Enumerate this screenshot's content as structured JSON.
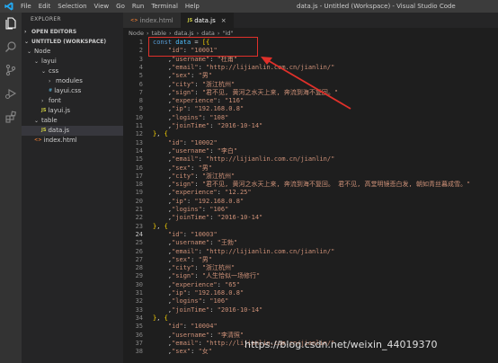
{
  "menu": [
    "File",
    "Edit",
    "Selection",
    "View",
    "Go",
    "Run",
    "Terminal",
    "Help"
  ],
  "window_title": "data.js - Untitled (Workspace) - Visual Studio Code",
  "sidebar": {
    "title": "EXPLORER",
    "open_editors": "OPEN EDITORS",
    "workspace": "UNTITLED (WORKSPACE)",
    "tree": [
      {
        "label": "Node",
        "type": "folder",
        "level": 0
      },
      {
        "label": "layui",
        "type": "folder",
        "level": 1
      },
      {
        "label": "css",
        "type": "folder",
        "level": 2
      },
      {
        "label": "modules",
        "type": "folder-collapsed",
        "level": 3
      },
      {
        "label": "layui.css",
        "type": "css",
        "level": 3
      },
      {
        "label": "font",
        "type": "folder-collapsed",
        "level": 2
      },
      {
        "label": "layui.js",
        "type": "js",
        "level": 2
      },
      {
        "label": "table",
        "type": "folder",
        "level": 1
      },
      {
        "label": "data.js",
        "type": "js",
        "level": 2,
        "selected": true
      },
      {
        "label": "index.html",
        "type": "html",
        "level": 1
      }
    ]
  },
  "tabs": [
    {
      "label": "index.html",
      "icon": "html-file-icon",
      "active": false
    },
    {
      "label": "data.js",
      "icon": "js-file-icon",
      "active": true
    }
  ],
  "breadcrumb": [
    "Node",
    "table",
    "data.js",
    "data",
    "\"id\""
  ],
  "editor": {
    "current_line": 24,
    "lines": [
      [
        [
          "k",
          "const "
        ],
        [
          "v",
          "data"
        ],
        [
          "p",
          " = "
        ],
        [
          "br",
          "[{"
        ]
      ],
      [
        [
          "p",
          "    "
        ],
        [
          "s",
          "\"id\""
        ],
        [
          "p",
          ": "
        ],
        [
          "s",
          "\"10001\""
        ]
      ],
      [
        [
          "p",
          "    ,"
        ],
        [
          "s",
          "\"username\""
        ],
        [
          "p",
          ": "
        ],
        [
          "s",
          "\"杜甫\""
        ]
      ],
      [
        [
          "p",
          "    ,"
        ],
        [
          "s",
          "\"email\""
        ],
        [
          "p",
          ": "
        ],
        [
          "s",
          "\"http://lijianlin.com.cn/jianlin/\""
        ]
      ],
      [
        [
          "p",
          "    ,"
        ],
        [
          "s",
          "\"sex\""
        ],
        [
          "p",
          ": "
        ],
        [
          "s",
          "\"男\""
        ]
      ],
      [
        [
          "p",
          "    ,"
        ],
        [
          "s",
          "\"city\""
        ],
        [
          "p",
          ": "
        ],
        [
          "s",
          "\"浙江杭州\""
        ]
      ],
      [
        [
          "p",
          "    ,"
        ],
        [
          "s",
          "\"sign\""
        ],
        [
          "p",
          ": "
        ],
        [
          "s",
          "\"君不见, 黄河之水天上来, 奔流到海不复回。\""
        ]
      ],
      [
        [
          "p",
          "    ,"
        ],
        [
          "s",
          "\"experience\""
        ],
        [
          "p",
          ": "
        ],
        [
          "s",
          "\"116\""
        ]
      ],
      [
        [
          "p",
          "    ,"
        ],
        [
          "s",
          "\"ip\""
        ],
        [
          "p",
          ": "
        ],
        [
          "s",
          "\"192.168.0.8\""
        ]
      ],
      [
        [
          "p",
          "    ,"
        ],
        [
          "s",
          "\"logins\""
        ],
        [
          "p",
          ": "
        ],
        [
          "s",
          "\"108\""
        ]
      ],
      [
        [
          "p",
          "    ,"
        ],
        [
          "s",
          "\"joinTime\""
        ],
        [
          "p",
          ": "
        ],
        [
          "s",
          "\"2016-10-14\""
        ]
      ],
      [
        [
          "br",
          "}"
        ],
        [
          "p",
          ", "
        ],
        [
          "br",
          "{"
        ]
      ],
      [
        [
          "p",
          "    "
        ],
        [
          "s",
          "\"id\""
        ],
        [
          "p",
          ": "
        ],
        [
          "s",
          "\"10002\""
        ]
      ],
      [
        [
          "p",
          "    ,"
        ],
        [
          "s",
          "\"username\""
        ],
        [
          "p",
          ": "
        ],
        [
          "s",
          "\"李白\""
        ]
      ],
      [
        [
          "p",
          "    ,"
        ],
        [
          "s",
          "\"email\""
        ],
        [
          "p",
          ": "
        ],
        [
          "s",
          "\"http://lijianlin.com.cn/jianlin/\""
        ]
      ],
      [
        [
          "p",
          "    ,"
        ],
        [
          "s",
          "\"sex\""
        ],
        [
          "p",
          ": "
        ],
        [
          "s",
          "\"男\""
        ]
      ],
      [
        [
          "p",
          "    ,"
        ],
        [
          "s",
          "\"city\""
        ],
        [
          "p",
          ": "
        ],
        [
          "s",
          "\"浙江杭州\""
        ]
      ],
      [
        [
          "p",
          "    ,"
        ],
        [
          "s",
          "\"sign\""
        ],
        [
          "p",
          ": "
        ],
        [
          "s",
          "\"君不见, 黄河之水天上来, 奔流到海不复回。 君不见, 高堂明镜悲白发, 朝如青丝暮成雪。\""
        ]
      ],
      [
        [
          "p",
          "    ,"
        ],
        [
          "s",
          "\"experience\""
        ],
        [
          "p",
          ": "
        ],
        [
          "s",
          "\"12.25\""
        ]
      ],
      [
        [
          "p",
          "    ,"
        ],
        [
          "s",
          "\"ip\""
        ],
        [
          "p",
          ": "
        ],
        [
          "s",
          "\"192.168.0.8\""
        ]
      ],
      [
        [
          "p",
          "    ,"
        ],
        [
          "s",
          "\"logins\""
        ],
        [
          "p",
          ": "
        ],
        [
          "s",
          "\"106\""
        ]
      ],
      [
        [
          "p",
          "    ,"
        ],
        [
          "s",
          "\"joinTime\""
        ],
        [
          "p",
          ": "
        ],
        [
          "s",
          "\"2016-10-14\""
        ]
      ],
      [
        [
          "br",
          "}"
        ],
        [
          "p",
          ", "
        ],
        [
          "br",
          "{"
        ]
      ],
      [
        [
          "p",
          "    "
        ],
        [
          "s",
          "\"id\""
        ],
        [
          "p",
          ": "
        ],
        [
          "s",
          "\"10003\""
        ]
      ],
      [
        [
          "p",
          "    ,"
        ],
        [
          "s",
          "\"username\""
        ],
        [
          "p",
          ": "
        ],
        [
          "s",
          "\"王勃\""
        ]
      ],
      [
        [
          "p",
          "    ,"
        ],
        [
          "s",
          "\"email\""
        ],
        [
          "p",
          ": "
        ],
        [
          "s",
          "\"http://lijianlin.com.cn/jianlin/\""
        ]
      ],
      [
        [
          "p",
          "    ,"
        ],
        [
          "s",
          "\"sex\""
        ],
        [
          "p",
          ": "
        ],
        [
          "s",
          "\"男\""
        ]
      ],
      [
        [
          "p",
          "    ,"
        ],
        [
          "s",
          "\"city\""
        ],
        [
          "p",
          ": "
        ],
        [
          "s",
          "\"浙江杭州\""
        ]
      ],
      [
        [
          "p",
          "    ,"
        ],
        [
          "s",
          "\"sign\""
        ],
        [
          "p",
          ": "
        ],
        [
          "s",
          "\"人生恰似一场修行\""
        ]
      ],
      [
        [
          "p",
          "    ,"
        ],
        [
          "s",
          "\"experience\""
        ],
        [
          "p",
          ": "
        ],
        [
          "s",
          "\"65\""
        ]
      ],
      [
        [
          "p",
          "    ,"
        ],
        [
          "s",
          "\"ip\""
        ],
        [
          "p",
          ": "
        ],
        [
          "s",
          "\"192.168.0.8\""
        ]
      ],
      [
        [
          "p",
          "    ,"
        ],
        [
          "s",
          "\"logins\""
        ],
        [
          "p",
          ": "
        ],
        [
          "s",
          "\"106\""
        ]
      ],
      [
        [
          "p",
          "    ,"
        ],
        [
          "s",
          "\"joinTime\""
        ],
        [
          "p",
          ": "
        ],
        [
          "s",
          "\"2016-10-14\""
        ]
      ],
      [
        [
          "br",
          "}"
        ],
        [
          "p",
          ", "
        ],
        [
          "br",
          "{"
        ]
      ],
      [
        [
          "p",
          "    "
        ],
        [
          "s",
          "\"id\""
        ],
        [
          "p",
          ": "
        ],
        [
          "s",
          "\"10004\""
        ]
      ],
      [
        [
          "p",
          "    ,"
        ],
        [
          "s",
          "\"username\""
        ],
        [
          "p",
          ": "
        ],
        [
          "s",
          "\"李清照\""
        ]
      ],
      [
        [
          "p",
          "    ,"
        ],
        [
          "s",
          "\"email\""
        ],
        [
          "p",
          ": "
        ],
        [
          "s",
          "\"http://lijianlin.com.cn/jianlin/\""
        ]
      ],
      [
        [
          "p",
          "    ,"
        ],
        [
          "s",
          "\"sex\""
        ],
        [
          "p",
          ": "
        ],
        [
          "s",
          "\"女\""
        ]
      ]
    ]
  },
  "watermark": "https://blog.csdn.net/weixin_44019370",
  "colors": {
    "annotation": "#e0302a"
  }
}
